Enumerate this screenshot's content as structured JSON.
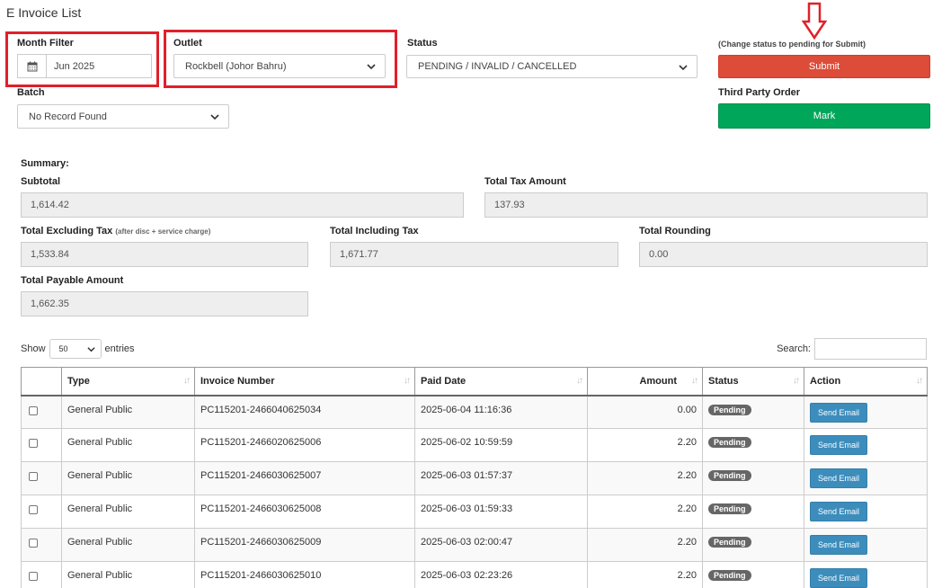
{
  "page_title": "E Invoice List",
  "filters": {
    "month_label": "Month Filter",
    "month_value": "Jun 2025",
    "outlet_label": "Outlet",
    "outlet_value": "Rockbell (Johor Bahru)",
    "status_label": "Status",
    "status_value": "PENDING / INVALID / CANCELLED",
    "batch_label": "Batch",
    "batch_value": "No Record Found"
  },
  "actions": {
    "hint": "(Change status to pending for Submit)",
    "submit_label": "Submit",
    "third_party_label": "Third Party Order",
    "mark_label": "Mark"
  },
  "summary": {
    "heading": "Summary:",
    "subtotal_label": "Subtotal",
    "subtotal_value": "1,614.42",
    "total_tax_label": "Total Tax Amount",
    "total_tax_value": "137.93",
    "excl_tax_label": "Total Excluding Tax",
    "excl_tax_note": "(after disc + service charge)",
    "excl_tax_value": "1,533.84",
    "incl_tax_label": "Total Including Tax",
    "incl_tax_value": "1,671.77",
    "rounding_label": "Total Rounding",
    "rounding_value": "0.00",
    "payable_label": "Total Payable Amount",
    "payable_value": "1,662.35"
  },
  "table_controls": {
    "show_label": "Show",
    "page_length": "50",
    "entries_label": "entries",
    "search_label": "Search:"
  },
  "table": {
    "columns": [
      "",
      "Type",
      "Invoice Number",
      "Paid Date",
      "Amount",
      "Status",
      "Action"
    ],
    "rows": [
      {
        "type": "General Public",
        "invoice": "PC115201-2466040625034",
        "paid_date": "2025-06-04 11:16:36",
        "amount": "0.00",
        "status": "Pending",
        "action": "Send Email"
      },
      {
        "type": "General Public",
        "invoice": "PC115201-2466020625006",
        "paid_date": "2025-06-02 10:59:59",
        "amount": "2.20",
        "status": "Pending",
        "action": "Send Email"
      },
      {
        "type": "General Public",
        "invoice": "PC115201-2466030625007",
        "paid_date": "2025-06-03 01:57:37",
        "amount": "2.20",
        "status": "Pending",
        "action": "Send Email"
      },
      {
        "type": "General Public",
        "invoice": "PC115201-2466030625008",
        "paid_date": "2025-06-03 01:59:33",
        "amount": "2.20",
        "status": "Pending",
        "action": "Send Email"
      },
      {
        "type": "General Public",
        "invoice": "PC115201-2466030625009",
        "paid_date": "2025-06-03 02:00:47",
        "amount": "2.20",
        "status": "Pending",
        "action": "Send Email"
      },
      {
        "type": "General Public",
        "invoice": "PC115201-2466030625010",
        "paid_date": "2025-06-03 02:23:26",
        "amount": "2.20",
        "status": "Pending",
        "action": "Send Email"
      }
    ]
  },
  "icons": {
    "calendar": "calendar-icon",
    "chevron": "chevron-down-icon",
    "sort": "sort-icon",
    "arrow": "down-arrow-icon"
  },
  "colors": {
    "highlight": "#e0202a",
    "submit": "#dd4b39",
    "mark": "#00a65a",
    "send_email": "#3c8dbc",
    "badge": "#666666"
  }
}
